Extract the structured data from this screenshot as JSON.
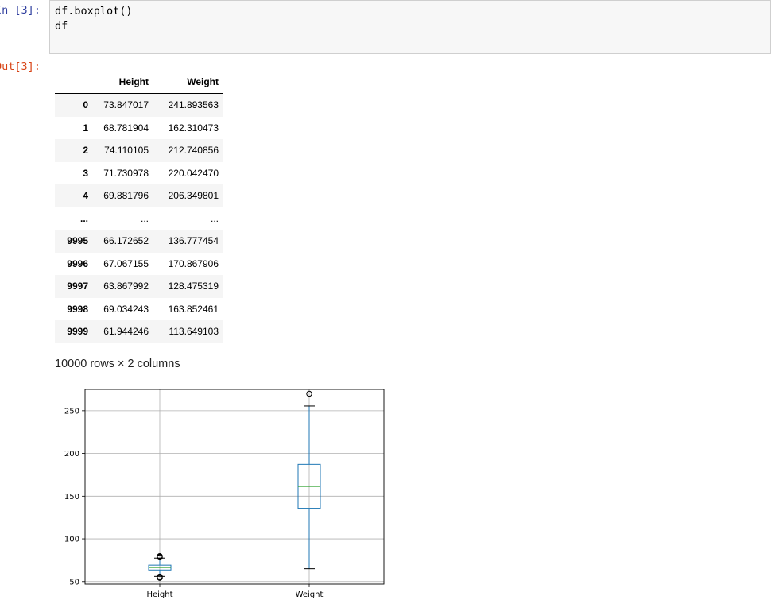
{
  "cell": {
    "in_prompt": "In [3]:",
    "code_lines": [
      "df.boxplot()",
      "df"
    ],
    "out_prompt": "Out[3]:"
  },
  "table": {
    "columns": [
      "Height",
      "Weight"
    ],
    "rows": [
      {
        "index": "0",
        "height": "73.847017",
        "weight": "241.893563"
      },
      {
        "index": "1",
        "height": "68.781904",
        "weight": "162.310473"
      },
      {
        "index": "2",
        "height": "74.110105",
        "weight": "212.740856"
      },
      {
        "index": "3",
        "height": "71.730978",
        "weight": "220.042470"
      },
      {
        "index": "4",
        "height": "69.881796",
        "weight": "206.349801"
      },
      {
        "index": "...",
        "height": "...",
        "weight": "..."
      },
      {
        "index": "9995",
        "height": "66.172652",
        "weight": "136.777454"
      },
      {
        "index": "9996",
        "height": "67.067155",
        "weight": "170.867906"
      },
      {
        "index": "9997",
        "height": "63.867992",
        "weight": "128.475319"
      },
      {
        "index": "9998",
        "height": "69.034243",
        "weight": "163.852461"
      },
      {
        "index": "9999",
        "height": "61.944246",
        "weight": "113.649103"
      }
    ],
    "shape": "10000 rows × 2 columns"
  },
  "chart_data": {
    "type": "boxplot",
    "categories": [
      "Height",
      "Weight"
    ],
    "ylim": [
      47,
      275
    ],
    "yticks": [
      50,
      100,
      150,
      200,
      250
    ],
    "grid": true,
    "boxes": [
      {
        "whisker_low": 56,
        "q1": 63.5,
        "median": 66.4,
        "q3": 69.2,
        "whisker_high": 77.5,
        "fliers": [
          54.3,
          55.1,
          55.8,
          78.2,
          79.0,
          79.8
        ]
      },
      {
        "whisker_low": 65,
        "q1": 135.8,
        "median": 161.4,
        "q3": 187.2,
        "whisker_high": 255.5,
        "fliers": [
          269.9
        ]
      }
    ],
    "colors": {
      "box": "#1f77b4",
      "median": "#2ca02c",
      "grid": "#b0b0b0",
      "flier": "#000000"
    }
  }
}
